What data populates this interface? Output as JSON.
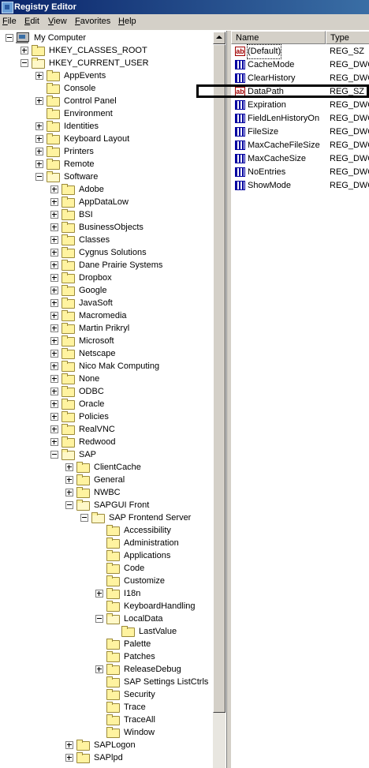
{
  "window": {
    "title": "Registry Editor"
  },
  "menu": [
    "File",
    "Edit",
    "View",
    "Favorites",
    "Help"
  ],
  "tree": [
    {
      "label": "My Computer",
      "level": 0,
      "expander": "minus",
      "icon": "computer-icon"
    },
    {
      "label": "HKEY_CLASSES_ROOT",
      "level": 1,
      "expander": "plus",
      "icon": "folder-icon"
    },
    {
      "label": "HKEY_CURRENT_USER",
      "level": 1,
      "expander": "minus",
      "icon": "folder-open-icon"
    },
    {
      "label": "AppEvents",
      "level": 2,
      "expander": "plus",
      "icon": "folder-icon"
    },
    {
      "label": "Console",
      "level": 2,
      "expander": "none",
      "icon": "folder-icon"
    },
    {
      "label": "Control Panel",
      "level": 2,
      "expander": "plus",
      "icon": "folder-icon"
    },
    {
      "label": "Environment",
      "level": 2,
      "expander": "none",
      "icon": "folder-icon"
    },
    {
      "label": "Identities",
      "level": 2,
      "expander": "plus",
      "icon": "folder-icon"
    },
    {
      "label": "Keyboard Layout",
      "level": 2,
      "expander": "plus",
      "icon": "folder-icon"
    },
    {
      "label": "Printers",
      "level": 2,
      "expander": "plus",
      "icon": "folder-icon"
    },
    {
      "label": "Remote",
      "level": 2,
      "expander": "plus",
      "icon": "folder-icon"
    },
    {
      "label": "Software",
      "level": 2,
      "expander": "minus",
      "icon": "folder-open-icon"
    },
    {
      "label": "Adobe",
      "level": 3,
      "expander": "plus",
      "icon": "folder-icon"
    },
    {
      "label": "AppDataLow",
      "level": 3,
      "expander": "plus",
      "icon": "folder-icon"
    },
    {
      "label": "BSI",
      "level": 3,
      "expander": "plus",
      "icon": "folder-icon"
    },
    {
      "label": "BusinessObjects",
      "level": 3,
      "expander": "plus",
      "icon": "folder-icon"
    },
    {
      "label": "Classes",
      "level": 3,
      "expander": "plus",
      "icon": "folder-icon"
    },
    {
      "label": "Cygnus Solutions",
      "level": 3,
      "expander": "plus",
      "icon": "folder-icon"
    },
    {
      "label": "Dane Prairie Systems",
      "level": 3,
      "expander": "plus",
      "icon": "folder-icon"
    },
    {
      "label": "Dropbox",
      "level": 3,
      "expander": "plus",
      "icon": "folder-icon"
    },
    {
      "label": "Google",
      "level": 3,
      "expander": "plus",
      "icon": "folder-icon"
    },
    {
      "label": "JavaSoft",
      "level": 3,
      "expander": "plus",
      "icon": "folder-icon"
    },
    {
      "label": "Macromedia",
      "level": 3,
      "expander": "plus",
      "icon": "folder-icon"
    },
    {
      "label": "Martin Prikryl",
      "level": 3,
      "expander": "plus",
      "icon": "folder-icon"
    },
    {
      "label": "Microsoft",
      "level": 3,
      "expander": "plus",
      "icon": "folder-icon"
    },
    {
      "label": "Netscape",
      "level": 3,
      "expander": "plus",
      "icon": "folder-icon"
    },
    {
      "label": "Nico Mak Computing",
      "level": 3,
      "expander": "plus",
      "icon": "folder-icon"
    },
    {
      "label": "None",
      "level": 3,
      "expander": "plus",
      "icon": "folder-icon"
    },
    {
      "label": "ODBC",
      "level": 3,
      "expander": "plus",
      "icon": "folder-icon"
    },
    {
      "label": "Oracle",
      "level": 3,
      "expander": "plus",
      "icon": "folder-icon"
    },
    {
      "label": "Policies",
      "level": 3,
      "expander": "plus",
      "icon": "folder-icon"
    },
    {
      "label": "RealVNC",
      "level": 3,
      "expander": "plus",
      "icon": "folder-icon"
    },
    {
      "label": "Redwood",
      "level": 3,
      "expander": "plus",
      "icon": "folder-icon"
    },
    {
      "label": "SAP",
      "level": 3,
      "expander": "minus",
      "icon": "folder-open-icon"
    },
    {
      "label": "ClientCache",
      "level": 4,
      "expander": "plus",
      "icon": "folder-icon"
    },
    {
      "label": "General",
      "level": 4,
      "expander": "plus",
      "icon": "folder-icon"
    },
    {
      "label": "NWBC",
      "level": 4,
      "expander": "plus",
      "icon": "folder-icon"
    },
    {
      "label": "SAPGUI Front",
      "level": 4,
      "expander": "minus",
      "icon": "folder-open-icon"
    },
    {
      "label": "SAP Frontend Server",
      "level": 5,
      "expander": "minus",
      "icon": "folder-open-icon"
    },
    {
      "label": "Accessibility",
      "level": 6,
      "expander": "none",
      "icon": "folder-icon"
    },
    {
      "label": "Administration",
      "level": 6,
      "expander": "none",
      "icon": "folder-icon"
    },
    {
      "label": "Applications",
      "level": 6,
      "expander": "none",
      "icon": "folder-icon"
    },
    {
      "label": "Code",
      "level": 6,
      "expander": "none",
      "icon": "folder-icon"
    },
    {
      "label": "Customize",
      "level": 6,
      "expander": "none",
      "icon": "folder-icon"
    },
    {
      "label": "I18n",
      "level": 6,
      "expander": "plus",
      "icon": "folder-icon"
    },
    {
      "label": "KeyboardHandling",
      "level": 6,
      "expander": "none",
      "icon": "folder-icon"
    },
    {
      "label": "LocalData",
      "level": 6,
      "expander": "minus",
      "icon": "folder-open-icon"
    },
    {
      "label": "LastValue",
      "level": 7,
      "expander": "none",
      "icon": "folder-icon"
    },
    {
      "label": "Palette",
      "level": 6,
      "expander": "none",
      "icon": "folder-icon"
    },
    {
      "label": "Patches",
      "level": 6,
      "expander": "none",
      "icon": "folder-icon"
    },
    {
      "label": "ReleaseDebug",
      "level": 6,
      "expander": "plus",
      "icon": "folder-icon"
    },
    {
      "label": "SAP Settings ListCtrls",
      "level": 6,
      "expander": "none",
      "icon": "folder-icon"
    },
    {
      "label": "Security",
      "level": 6,
      "expander": "none",
      "icon": "folder-icon"
    },
    {
      "label": "Trace",
      "level": 6,
      "expander": "none",
      "icon": "folder-icon"
    },
    {
      "label": "TraceAll",
      "level": 6,
      "expander": "none",
      "icon": "folder-icon"
    },
    {
      "label": "Window",
      "level": 6,
      "expander": "none",
      "icon": "folder-icon"
    },
    {
      "label": "SAPLogon",
      "level": 4,
      "expander": "plus",
      "icon": "folder-icon"
    },
    {
      "label": "SAPlpd",
      "level": 4,
      "expander": "plus",
      "icon": "folder-icon"
    }
  ],
  "list": {
    "columns": [
      "Name",
      "Type"
    ],
    "rows": [
      {
        "name": "(Default)",
        "type": "REG_SZ",
        "icon": "string-value-icon",
        "focused": true
      },
      {
        "name": "CacheMode",
        "type": "REG_DWC",
        "icon": "binary-value-icon"
      },
      {
        "name": "ClearHistory",
        "type": "REG_DWC",
        "icon": "binary-value-icon"
      },
      {
        "name": "DataPath",
        "type": "REG_SZ",
        "icon": "string-value-icon"
      },
      {
        "name": "Expiration",
        "type": "REG_DWC",
        "icon": "binary-value-icon"
      },
      {
        "name": "FieldLenHistoryOn",
        "type": "REG_DWC",
        "icon": "binary-value-icon"
      },
      {
        "name": "FileSize",
        "type": "REG_DWC",
        "icon": "binary-value-icon"
      },
      {
        "name": "MaxCacheFileSize",
        "type": "REG_DWC",
        "icon": "binary-value-icon"
      },
      {
        "name": "MaxCacheSize",
        "type": "REG_DWC",
        "icon": "binary-value-icon"
      },
      {
        "name": "NoEntries",
        "type": "REG_DWC",
        "icon": "binary-value-icon"
      },
      {
        "name": "ShowMode",
        "type": "REG_DWC",
        "icon": "binary-value-icon"
      }
    ]
  },
  "string_icon_text": "ab"
}
